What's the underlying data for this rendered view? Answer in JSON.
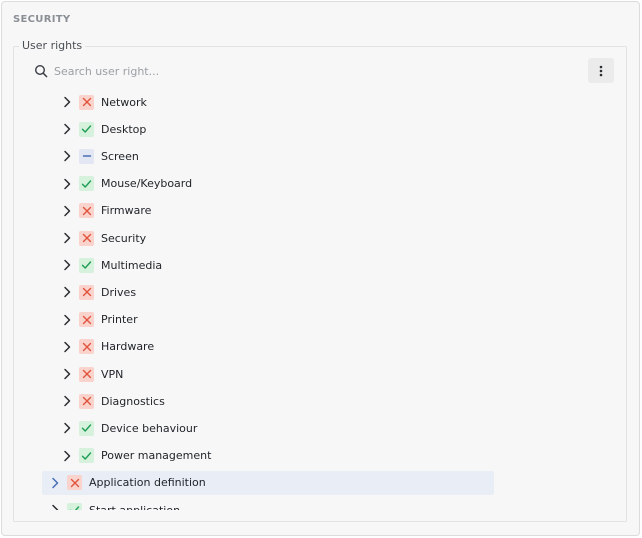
{
  "section": {
    "title": "SECURITY"
  },
  "group": {
    "legend": "User rights"
  },
  "search": {
    "placeholder": "Search user right..."
  },
  "colors": {
    "deny": "#e0533d",
    "allow": "#1f9d55",
    "partial": "#4a6fb5",
    "selected_bg": "#e8edf6"
  },
  "tree": {
    "children": [
      {
        "label": "Network",
        "status": "deny"
      },
      {
        "label": "Desktop",
        "status": "allow"
      },
      {
        "label": "Screen",
        "status": "partial"
      },
      {
        "label": "Mouse/Keyboard",
        "status": "allow"
      },
      {
        "label": "Firmware",
        "status": "deny"
      },
      {
        "label": "Security",
        "status": "deny"
      },
      {
        "label": "Multimedia",
        "status": "allow"
      },
      {
        "label": "Drives",
        "status": "deny"
      },
      {
        "label": "Printer",
        "status": "deny"
      },
      {
        "label": "Hardware",
        "status": "deny"
      },
      {
        "label": "VPN",
        "status": "deny"
      },
      {
        "label": "Diagnostics",
        "status": "deny"
      },
      {
        "label": "Device behaviour",
        "status": "allow"
      },
      {
        "label": "Power management",
        "status": "allow"
      }
    ],
    "parents": [
      {
        "label": "Application definition",
        "status": "deny",
        "selected": true
      },
      {
        "label": "Start application",
        "status": "allow",
        "selected": false
      }
    ]
  }
}
